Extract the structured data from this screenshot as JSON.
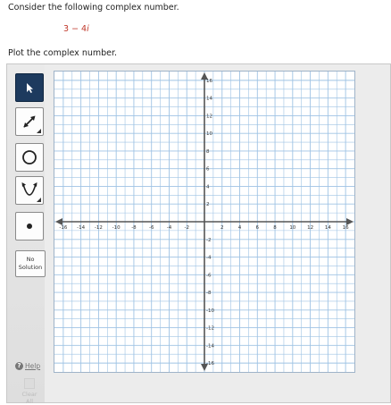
{
  "question": {
    "prompt": "Consider the following complex number.",
    "real_part": "3 − 4",
    "imag_unit": "i"
  },
  "instruction": "Plot the complex number.",
  "tools": [
    {
      "name": "pointer-tool",
      "icon": "cursor-arrow-icon",
      "active": true
    },
    {
      "name": "segment-tool",
      "icon": "diagonal-arrow-icon",
      "active": false
    },
    {
      "name": "circle-tool",
      "icon": "circle-icon",
      "active": false
    },
    {
      "name": "parabola-tool",
      "icon": "parabola-icon",
      "active": false
    },
    {
      "name": "point-tool",
      "icon": "point-icon",
      "active": false
    }
  ],
  "no_solution": {
    "line1": "No",
    "line2": "Solution"
  },
  "help": {
    "icon": "question-circle-icon",
    "label": "Help"
  },
  "clear_all": {
    "icon": "clear-box-icon",
    "line1": "Clear",
    "line2": "All"
  },
  "graph": {
    "x_range": [
      -17,
      17
    ],
    "y_range": [
      -17,
      17
    ],
    "grid_step": 1,
    "x_tick_labels": [
      "-16",
      "-14",
      "-12",
      "-10",
      "-8",
      "-6",
      "-4",
      "-2",
      "2",
      "4",
      "6",
      "8",
      "10",
      "12",
      "14",
      "16"
    ],
    "y_tick_labels": [
      "16",
      "14",
      "12",
      "10",
      "8",
      "6",
      "4",
      "2",
      "-2",
      "-4",
      "-6",
      "-8",
      "-10",
      "-12",
      "-14",
      "-16"
    ],
    "axis_color": "#555555",
    "grid_color": "#9fc3e4"
  }
}
